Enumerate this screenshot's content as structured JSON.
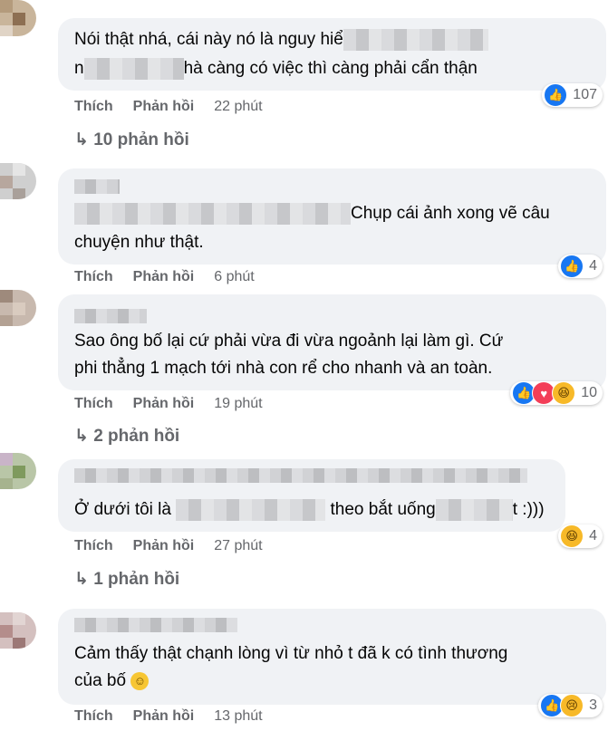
{
  "ui": {
    "like": "Thích",
    "reply": "Phản hồi"
  },
  "comments": [
    {
      "line1": "Nói thật nhá, cái này nó là nguy hiể",
      "line2_a": "n",
      "line2_b": "hà càng có việc thì càng phải cẩn thận",
      "time": "22 phút",
      "reaction_count": "107",
      "replies": "10 phản hồi"
    },
    {
      "line1": "Chụp cái ảnh xong vẽ câu",
      "line2": "chuyện như thật.",
      "time": "6 phút",
      "reaction_count": "4"
    },
    {
      "line1": "Sao ông bố lại cứ phải vừa đi vừa ngoảnh lại làm gì. Cứ",
      "line2": "phi thẳng 1 mạch tới nhà con rể cho nhanh và an toàn.",
      "time": "19 phút",
      "reaction_count": "10",
      "replies": "2 phản hồi"
    },
    {
      "line1_a": "Ở dưới tôi là",
      "line1_b": "theo bắt uống",
      "line1_c": "t :)))",
      "time": "27 phút",
      "reaction_count": "4",
      "replies": "1 phản hồi"
    },
    {
      "line1": "Cảm thấy thật chạnh lòng vì từ nhỏ t đã k có tình thương",
      "line2": "của bố",
      "time": "13 phút",
      "reaction_count": "3"
    }
  ]
}
